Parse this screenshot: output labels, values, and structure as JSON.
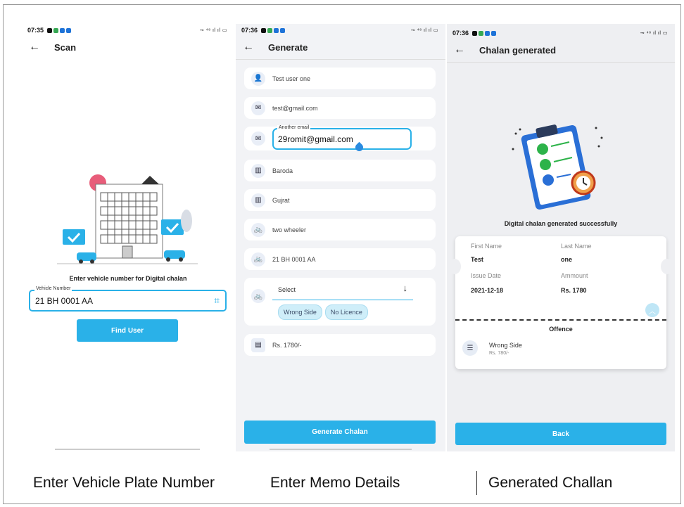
{
  "screen1": {
    "status_time": "07:35",
    "status_right": "ૐ ₹⁸⁸ ∷ ıl ▭",
    "header": {
      "back_icon": "arrow-left-icon",
      "title": "Scan"
    },
    "prompt": "Enter vehicle number for Digital chalan",
    "vehicle_field": {
      "label": "Vehicle Number",
      "value": "21 BH 0001 AA",
      "scan_icon": "scan-icon"
    },
    "find_button": "Find User"
  },
  "screen2": {
    "status_time": "07:36",
    "header": {
      "back_icon": "arrow-left-icon",
      "title": "Generate"
    },
    "fields": [
      {
        "icon": "person-icon",
        "value": "Test user one"
      },
      {
        "icon": "mail-icon",
        "value": "test@gmail.com"
      },
      {
        "icon": "mail-icon",
        "label": "Another email",
        "value": "29romit@gmail.com"
      },
      {
        "icon": "city-icon",
        "value": "Baroda"
      },
      {
        "icon": "city-icon",
        "value": "Gujrat"
      },
      {
        "icon": "bike-icon",
        "value": "two wheeler"
      },
      {
        "icon": "bike-icon",
        "value": "21 BH 0001 AA"
      }
    ],
    "offence_select": {
      "placeholder": "Select",
      "chips": [
        "Wrong Side",
        "No Licence"
      ]
    },
    "amount": "Rs. 1780/-",
    "generate_button": "Generate Chalan"
  },
  "screen3": {
    "status_time": "07:36",
    "header": {
      "back_icon": "arrow-left-icon",
      "title": "Chalan generated"
    },
    "success_text": "Digital chalan generated successfully",
    "card": {
      "first_name_label": "First Name",
      "first_name": "Test",
      "last_name_label": "Last Name",
      "last_name": "one",
      "issue_date_label": "Issue Date",
      "issue_date": "2021-12-18",
      "amount_label": "Ammount",
      "amount": "Rs. 1780",
      "offence_title": "Offence",
      "offence_name": "Wrong Side",
      "offence_amount": "Rs. 780/-"
    },
    "back_button": "Back"
  },
  "captions": [
    "Enter Vehicle Plate Number",
    "Enter Memo Details",
    "Generated Challan"
  ],
  "colors": {
    "accent": "#2ab1e8",
    "focus_border": "#2ab1e8",
    "success_green": "#2db34a"
  }
}
